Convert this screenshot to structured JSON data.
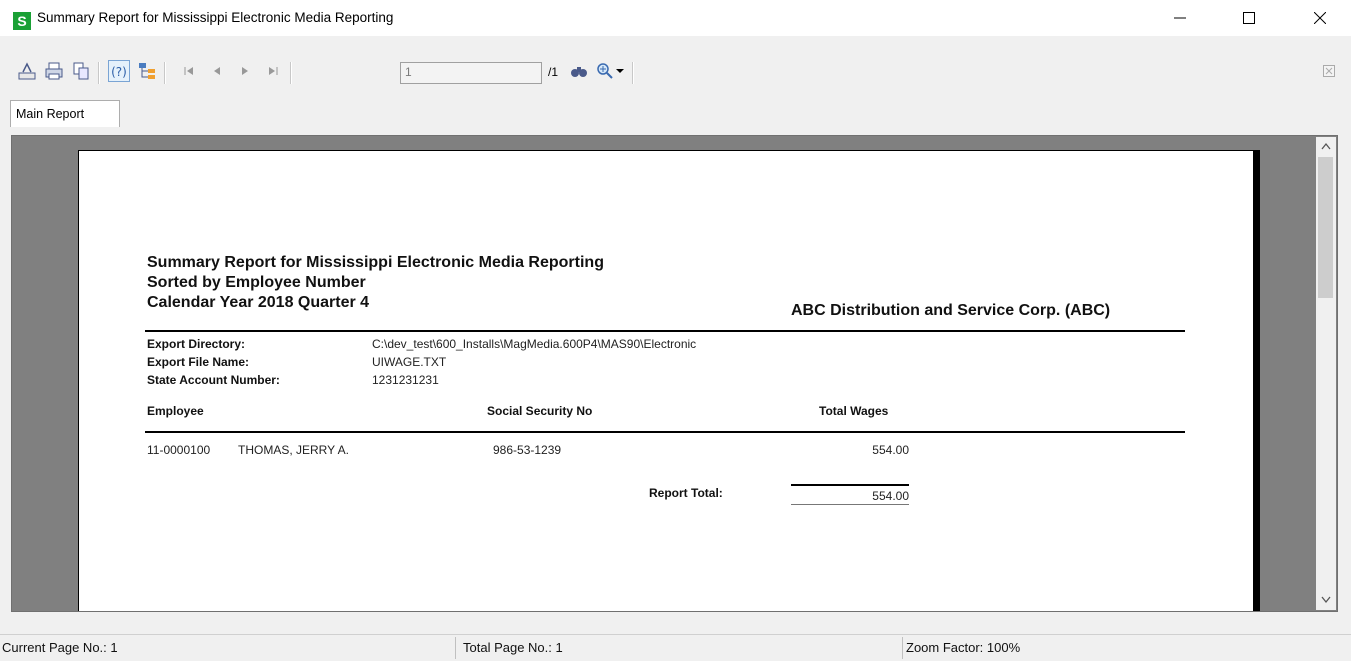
{
  "window": {
    "title": "Summary Report for Mississippi Electronic Media Reporting",
    "app_icon_letter": "S"
  },
  "toolbar": {
    "page_value": "1",
    "page_total": "/1",
    "icons": [
      "export-icon",
      "print-icon",
      "copy-icon",
      "help-icon",
      "group-tree-icon",
      "first-page-icon",
      "prev-page-icon",
      "next-page-icon",
      "last-page-icon",
      "search-icon",
      "zoom-icon",
      "zoom-dropdown-icon",
      "close-view-icon"
    ]
  },
  "tabs": {
    "main": "Main Report"
  },
  "report": {
    "title_line1": "Summary Report for Mississippi Electronic Media Reporting",
    "title_line2": "Sorted by Employee Number",
    "title_line3": "Calendar Year 2018 Quarter 4",
    "company": "ABC Distribution and Service Corp. (ABC)",
    "export_directory_label": "Export Directory:",
    "export_directory_value": "C:\\dev_test\\600_Installs\\MagMedia.600P4\\MAS90\\Electronic",
    "export_file_label": "Export File Name:",
    "export_file_value": "UIWAGE.TXT",
    "state_account_label": "State Account Number:",
    "state_account_value": "1231231231",
    "columns": {
      "employee": "Employee",
      "ssn": "Social Security No",
      "total_wages": "Total Wages"
    },
    "rows": [
      {
        "employee_no": "11-0000100",
        "name": "THOMAS, JERRY A.",
        "ssn": "986-53-1239",
        "wages": "554.00"
      }
    ],
    "report_total_label": "Report Total:",
    "report_total_value": "554.00"
  },
  "status": {
    "current_page": "Current Page No.: 1",
    "total_page": "Total Page No.: 1",
    "zoom": "Zoom Factor: 100%"
  }
}
